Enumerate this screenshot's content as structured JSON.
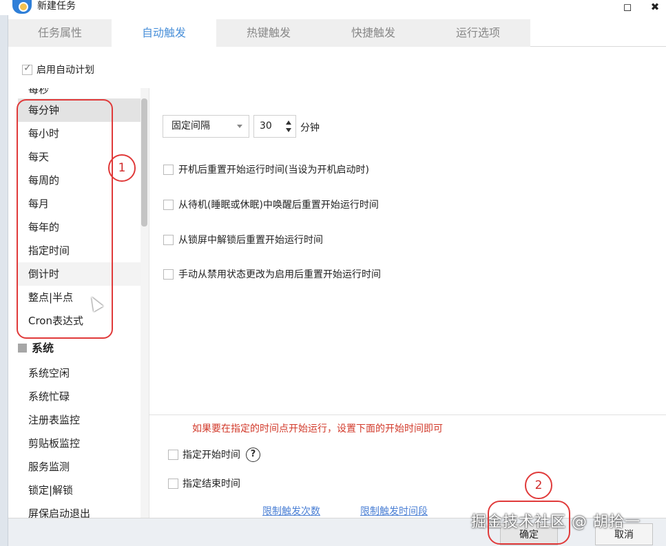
{
  "window": {
    "title": "新建任务",
    "maximize_glyph": "◻",
    "close_glyph": "✖"
  },
  "tabs": [
    {
      "label": "任务属性",
      "active": false
    },
    {
      "label": "自动触发",
      "active": true
    },
    {
      "label": "热键触发",
      "active": false
    },
    {
      "label": "快捷触发",
      "active": false
    },
    {
      "label": "运行选项",
      "active": false
    }
  ],
  "schedule": {
    "enable_label": "启用自动计划",
    "enabled": true,
    "items": [
      {
        "label": "每秒"
      },
      {
        "label": "每分钟",
        "selected": true
      },
      {
        "label": "每小时"
      },
      {
        "label": "每天"
      },
      {
        "label": "每周的"
      },
      {
        "label": "每月"
      },
      {
        "label": "每年的"
      },
      {
        "label": "指定时间"
      },
      {
        "label": "倒计时"
      },
      {
        "label": "整点|半点"
      },
      {
        "label": "Cron表达式"
      }
    ],
    "system_header": "系统",
    "system_items": [
      {
        "label": "系统空闲"
      },
      {
        "label": "系统忙碌"
      },
      {
        "label": "注册表监控"
      },
      {
        "label": "剪贴板监控"
      },
      {
        "label": "服务监测"
      },
      {
        "label": "锁定|解锁"
      },
      {
        "label": "屏保启动退出"
      }
    ]
  },
  "settings": {
    "interval_mode": "固定间隔",
    "interval_value": "30",
    "interval_unit": "分钟",
    "options": [
      {
        "label": "开机后重置开始运行时间(当设为开机启动时)",
        "checked": false
      },
      {
        "label": "从待机(睡眠或休眠)中唤醒后重置开始运行时间",
        "checked": false
      },
      {
        "label": "从锁屏中解锁后重置开始运行时间",
        "checked": false
      },
      {
        "label": "手动从禁用状态更改为启用后重置开始运行时间",
        "checked": false
      }
    ]
  },
  "bottom": {
    "hint": "如果要在指定的时间点开始运行，设置下面的开始时间即可",
    "hint_color": "#d23a2b",
    "start_time_label": "指定开始时间",
    "end_time_label": "指定结束时间",
    "help_glyph": "?",
    "link_limit_count": "限制触发次数",
    "link_limit_period": "限制触发时间段"
  },
  "footer": {
    "ok_label": "确定",
    "cancel_label": "取消",
    "watermark": "掘金技术社区 @ 胡拾一"
  },
  "annotations": {
    "marker_1": "1",
    "marker_2": "2",
    "color": "#e03a3a"
  }
}
